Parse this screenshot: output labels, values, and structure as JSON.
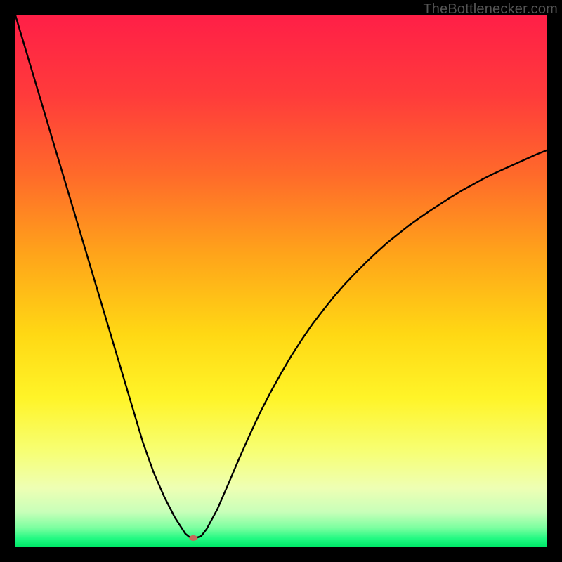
{
  "watermark": "TheBottlenecker.com",
  "chart_data": {
    "type": "line",
    "title": "",
    "xlabel": "",
    "ylabel": "",
    "xlim": [
      0,
      100
    ],
    "ylim": [
      0,
      100
    ],
    "grid": false,
    "marker": {
      "x": 33.5,
      "y": 1.6,
      "color": "#c66a5a",
      "rx": 6,
      "ry": 4
    },
    "x": [
      0,
      2,
      4,
      6,
      8,
      10,
      12,
      14,
      16,
      18,
      20,
      22,
      24,
      26,
      28,
      30,
      32,
      33,
      34,
      35,
      36,
      38,
      40,
      42,
      44,
      46,
      48,
      50,
      52,
      54,
      56,
      58,
      60,
      62,
      64,
      66,
      68,
      70,
      72,
      74,
      76,
      78,
      80,
      82,
      84,
      86,
      88,
      90,
      92,
      94,
      96,
      98,
      100
    ],
    "y": [
      100,
      93.3,
      86.6,
      79.9,
      73.2,
      66.5,
      59.8,
      53.1,
      46.4,
      39.7,
      33.0,
      26.3,
      19.6,
      14.0,
      9.4,
      5.5,
      2.4,
      1.6,
      1.6,
      2.0,
      3.3,
      7.0,
      11.6,
      16.3,
      20.8,
      25.1,
      29.0,
      32.6,
      36.0,
      39.1,
      42.0,
      44.6,
      47.1,
      49.4,
      51.5,
      53.5,
      55.4,
      57.2,
      58.8,
      60.4,
      61.8,
      63.2,
      64.5,
      65.8,
      67.0,
      68.1,
      69.2,
      70.2,
      71.1,
      72.0,
      72.9,
      73.8,
      74.6
    ],
    "background_gradient_stops": [
      {
        "offset": 0.0,
        "color": "#ff1f47"
      },
      {
        "offset": 0.15,
        "color": "#ff3b3b"
      },
      {
        "offset": 0.3,
        "color": "#ff6a2a"
      },
      {
        "offset": 0.45,
        "color": "#ffa41a"
      },
      {
        "offset": 0.6,
        "color": "#ffd814"
      },
      {
        "offset": 0.72,
        "color": "#fff428"
      },
      {
        "offset": 0.82,
        "color": "#f7ff73"
      },
      {
        "offset": 0.89,
        "color": "#eeffb4"
      },
      {
        "offset": 0.935,
        "color": "#c8ffb9"
      },
      {
        "offset": 0.965,
        "color": "#7bffa0"
      },
      {
        "offset": 0.985,
        "color": "#21f982"
      },
      {
        "offset": 1.0,
        "color": "#00e869"
      }
    ]
  }
}
